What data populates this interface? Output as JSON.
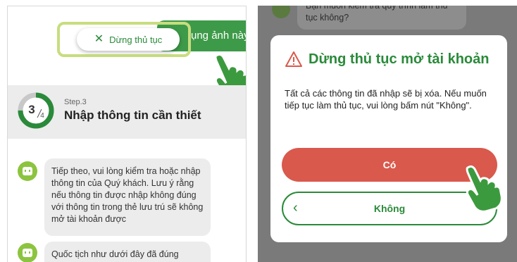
{
  "left": {
    "tab_label": "ụng ảnh này",
    "stop_button": "Dừng thủ tục",
    "step": {
      "kicker": "Step.3",
      "title": "Nhập thông tin cần thiết",
      "current": "3",
      "total": "4",
      "progress_fraction": 0.75
    },
    "messages": [
      "Tiếp theo, vui lòng kiểm tra hoặc nhập thông tin của Quý khách. Lưu ý rằng nếu thông tin được nhập không đúng với thông tin trong thẻ lưu trú sẽ không mở tài khoản được",
      "Quốc tịch như dưới đây đã đúng"
    ]
  },
  "right": {
    "background_message": "Bạn muốn kiểm tra quy trình làm thủ tục không?",
    "modal": {
      "title": "Dừng thủ tục mở tài khoản",
      "body": "Tất cả các thông tin đã nhập sẽ bị xóa. Nếu muốn tiếp tục làm thủ tục, vui lòng bấm nút \"Không\".",
      "yes_label": "Có",
      "no_label": "Không"
    }
  },
  "colors": {
    "brand_green": "#2a8a3a",
    "tab_green": "#3d9a48",
    "accent_lime": "#8cc43f",
    "danger_red": "#d9594c"
  },
  "icons": [
    "close-icon",
    "hand-pointer-icon",
    "bot-icon",
    "warning-triangle-icon",
    "chevron-left-icon"
  ]
}
